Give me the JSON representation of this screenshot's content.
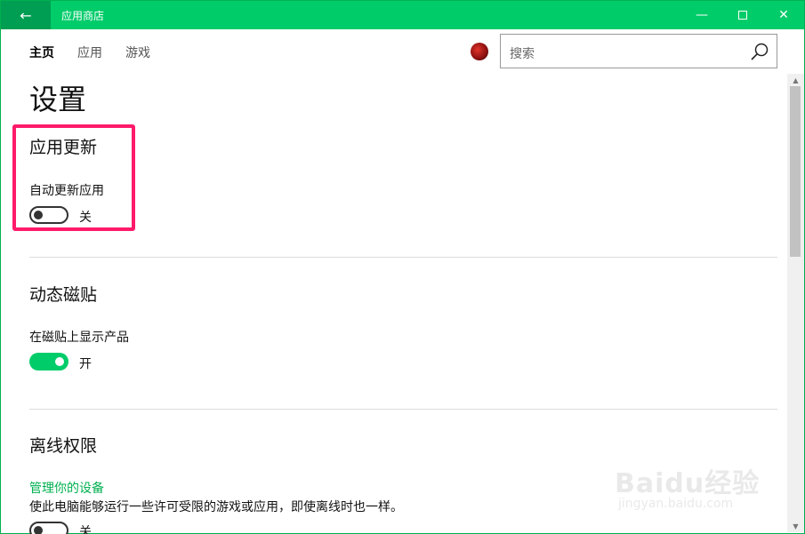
{
  "titlebar": {
    "back_icon": "back-arrow-icon",
    "app_title": "应用商店",
    "minimize_icon": "minimize-icon",
    "maximize_icon": "maximize-icon",
    "close_icon": "close-icon"
  },
  "nav": {
    "tabs": [
      {
        "label": "主页",
        "active": true
      },
      {
        "label": "应用",
        "active": false
      },
      {
        "label": "游戏",
        "active": false
      }
    ],
    "search_placeholder": "搜索"
  },
  "page": {
    "title": "设置",
    "sections": [
      {
        "title": "应用更新",
        "setting_label": "自动更新应用",
        "toggle_on": false,
        "toggle_state": "关"
      },
      {
        "title": "动态磁贴",
        "setting_label": "在磁贴上显示产品",
        "toggle_on": true,
        "toggle_state": "开"
      },
      {
        "title": "离线权限",
        "link": "管理你的设备",
        "description": "使此电脑能够运行一些许可受限的游戏或应用，即使离线时也一样。",
        "toggle_state": "关"
      }
    ]
  },
  "colors": {
    "accent": "#00cc6a",
    "highlight": "#ff1a6a"
  },
  "watermark": {
    "main": "Baidu经验",
    "sub": "jingyan.baidu.com"
  }
}
